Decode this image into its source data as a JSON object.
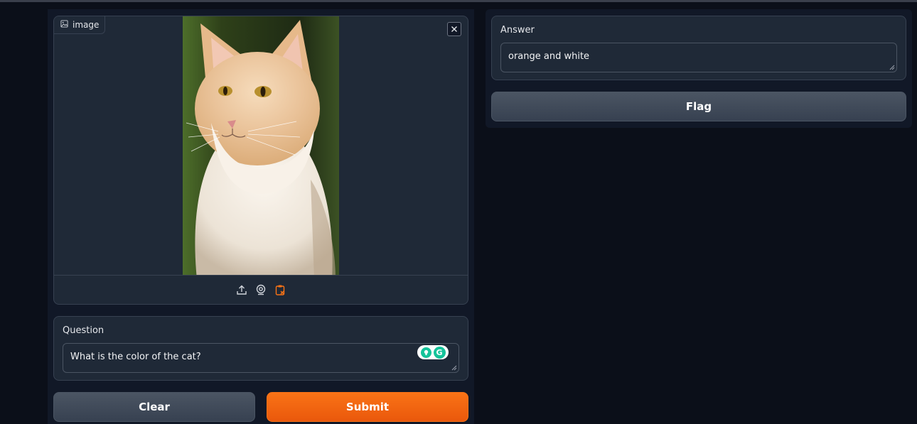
{
  "image_input": {
    "label": "image",
    "label_icon": "image-icon",
    "close_icon": "close-icon",
    "toolbar_icons": [
      "upload-icon",
      "webcam-icon",
      "clipboard-icon"
    ],
    "accent_color": "#f97316"
  },
  "question": {
    "label": "Question",
    "value": "What is the color of the cat?"
  },
  "buttons": {
    "clear": "Clear",
    "submit": "Submit",
    "flag": "Flag"
  },
  "answer": {
    "label": "Answer",
    "value": "orange and white"
  },
  "colors": {
    "background": "#0b0f19",
    "panel": "#1f2937",
    "submit": "#f97316",
    "secondary_button": "#4b5563"
  }
}
